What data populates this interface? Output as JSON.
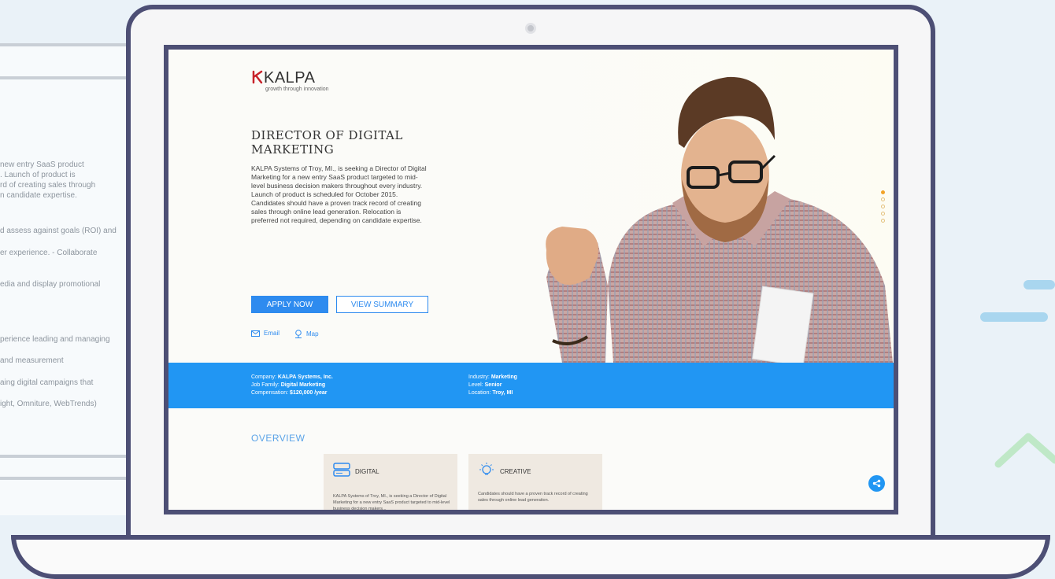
{
  "background_page": {
    "lines": [
      "new entry SaaS product\n. Launch of product is\nrd of creating sales through\nn candidate expertise.",
      "d assess against goals (ROI) and",
      "er experience. - Collaborate",
      "edia and display promotional",
      "perience leading and managing",
      " and measurement",
      "aing digital campaigns that",
      "ight, Omniture, WebTrends)"
    ]
  },
  "brand": {
    "name": "KALPA",
    "tagline": "growth through innovation",
    "accent_color": "#c8232b"
  },
  "job": {
    "title": "DIRECTOR OF DIGITAL MARKETING",
    "description": "KALPA Systems of Troy, MI., is seeking a Director of Digital Marketing for a new entry SaaS product targeted to mid-level business decision makers throughout every industry. Launch of product is scheduled for October 2015. Candidates should have a proven track record of creating sales through online lead generation. Relocation is preferred not required, depending on candidate expertise.",
    "apply_label": "APPLY NOW",
    "summary_label": "VIEW SUMMARY",
    "email_label": "Email",
    "map_label": "Map"
  },
  "info": {
    "company_label": "Company:",
    "company": "KALPA Systems, Inc.",
    "family_label": "Job Family:",
    "family": "Digital Marketing",
    "compensation_label": "Compensation:",
    "compensation": "$120,000 /year",
    "industry_label": "Industry:",
    "industry": "Marketing",
    "level_label": "Level:",
    "level": "Senior",
    "location_label": "Location:",
    "location": "Troy, MI",
    "bar_color": "#2196f3"
  },
  "overview": {
    "heading": "OVERVIEW",
    "cards": [
      {
        "title": "DIGITAL",
        "icon": "hard-drive-icon",
        "text": "KALPA Systems of Troy, MI., is seeking a Director of Digital Marketing for a new entry SaaS product targeted to mid-level business decision makers..."
      },
      {
        "title": "CREATIVE",
        "icon": "lightbulb-icon",
        "text": "Candidates should have a proven track record of creating sales through online lead generation."
      }
    ]
  },
  "slider": {
    "count": 5,
    "active": 1
  },
  "colors": {
    "primary": "#2e8bef",
    "laptop_frame": "#4d4f75",
    "card_bg": "#efe9e1"
  }
}
